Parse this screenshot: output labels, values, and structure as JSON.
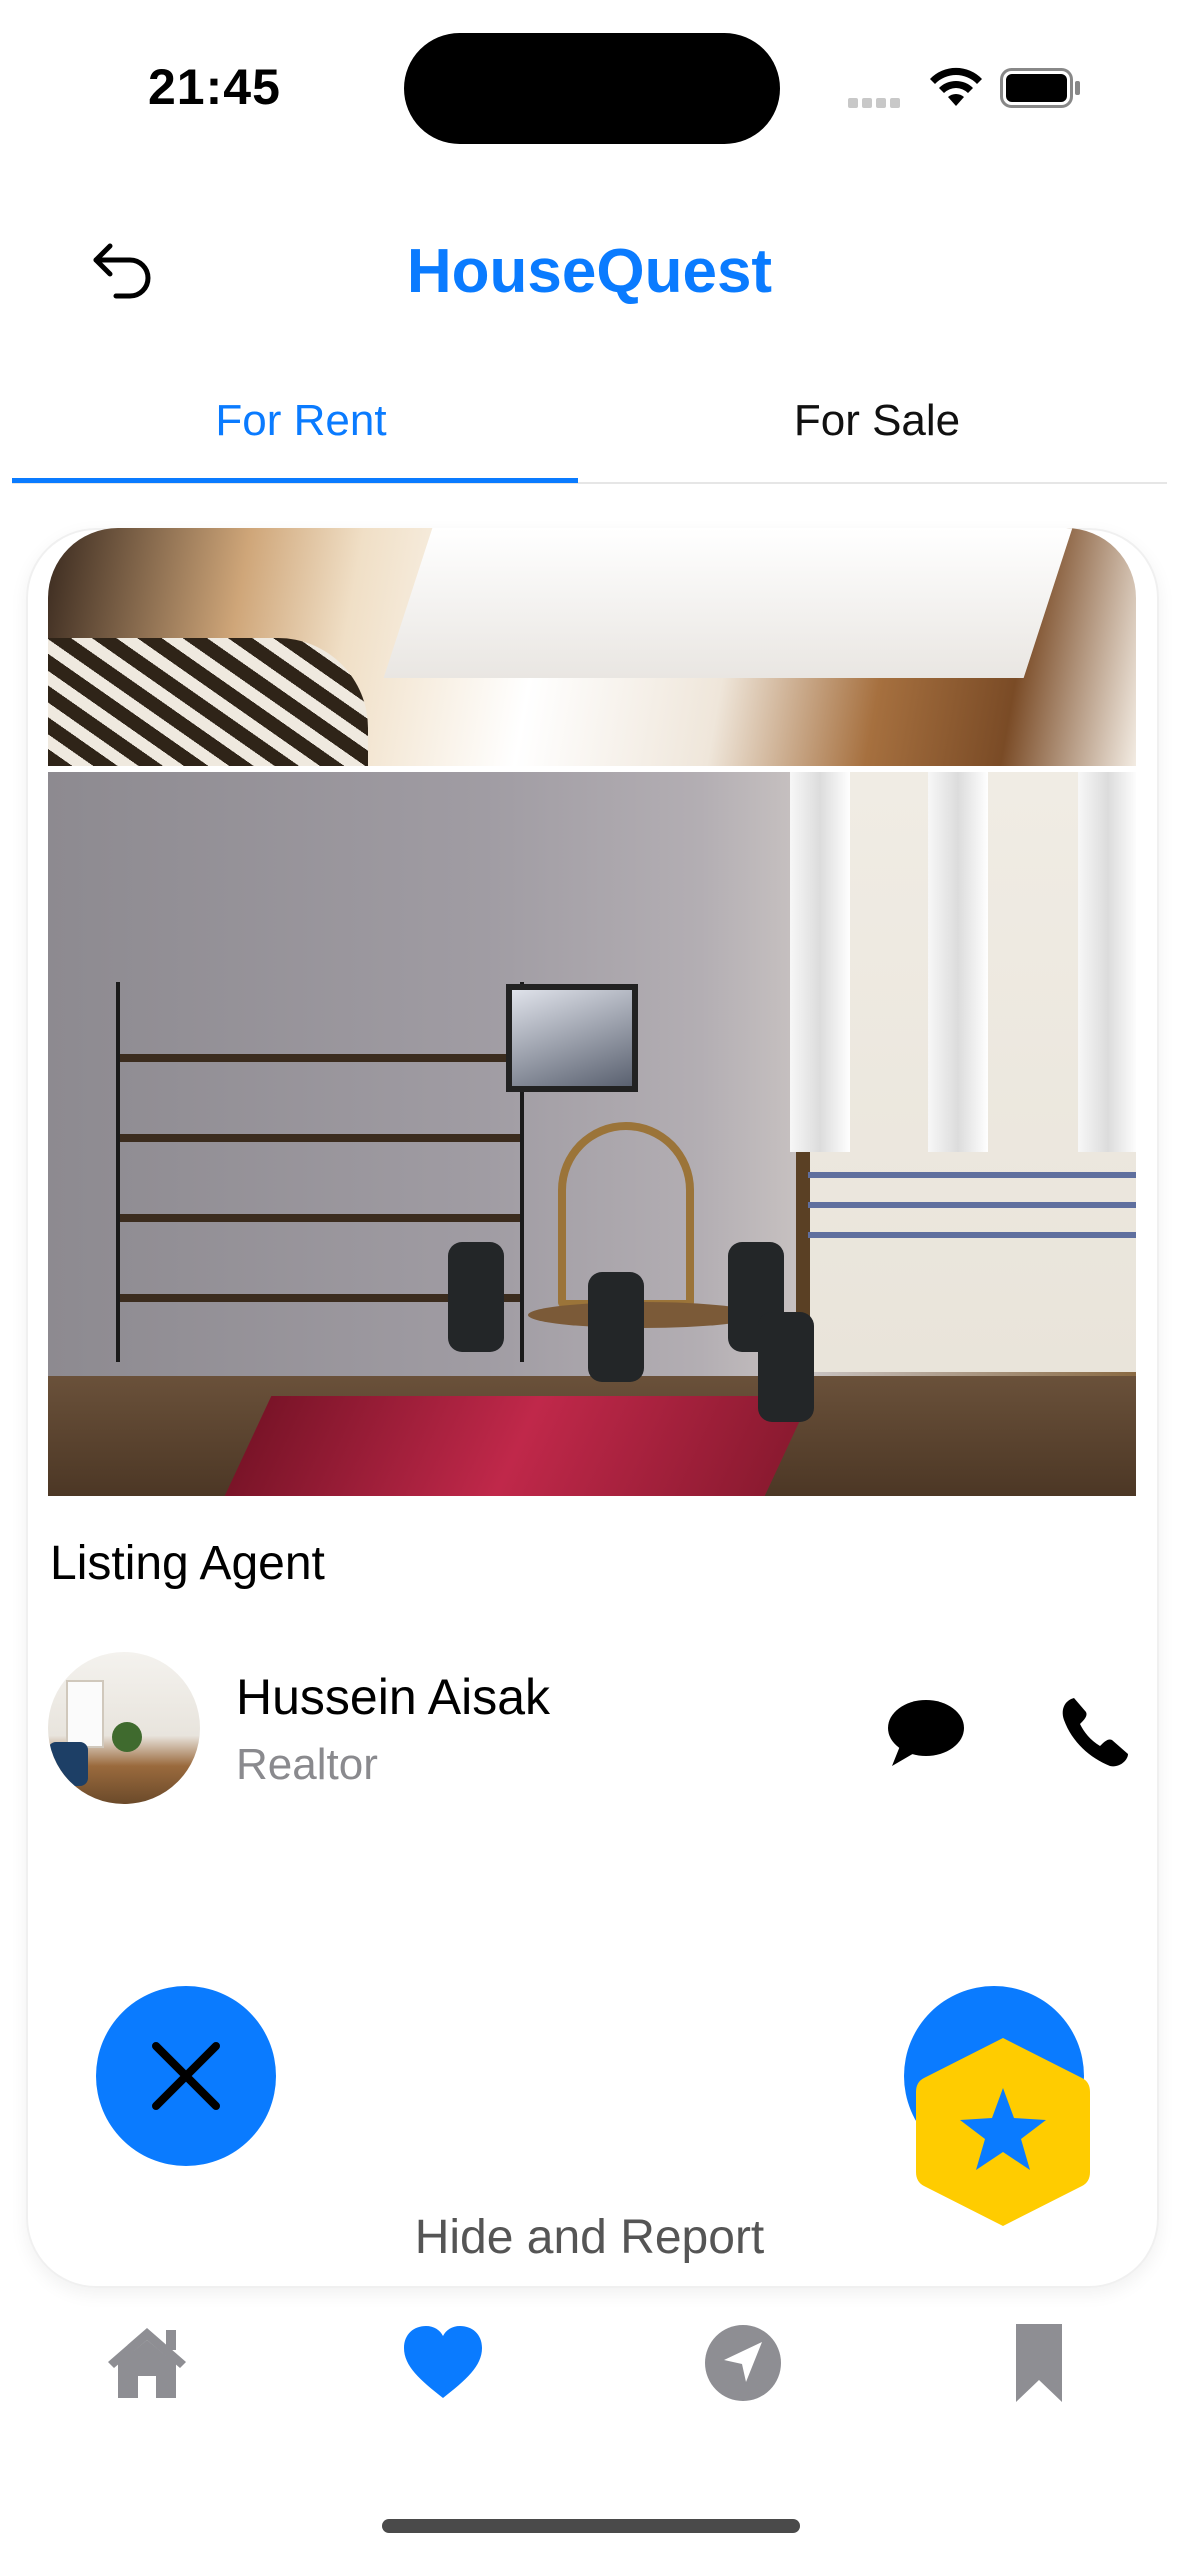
{
  "status_bar": {
    "time": "21:45",
    "icons": [
      "cellular-signal-icon",
      "wifi-icon",
      "battery-icon"
    ]
  },
  "header": {
    "title": "HouseQuest",
    "back_icon": "back-arrow-icon"
  },
  "tabs": [
    {
      "label": "For Rent",
      "selected": true
    },
    {
      "label": "For Sale",
      "selected": false
    }
  ],
  "listing": {
    "photos": [
      "bedroom-photo",
      "living-room-photo"
    ],
    "agent_section_title": "Listing Agent",
    "agent": {
      "name": "Hussein Aisak",
      "role": "Realtor"
    },
    "contact_icons": [
      "message-icon",
      "phone-icon"
    ]
  },
  "actions": {
    "dismiss_icon": "close-icon",
    "favorite_icon": "star-icon",
    "hide_report_label": "Hide and Report"
  },
  "tab_bar": {
    "items": [
      {
        "icon": "home-icon",
        "selected": false
      },
      {
        "icon": "heart-icon",
        "selected": true
      },
      {
        "icon": "location-arrow-icon",
        "selected": false
      },
      {
        "icon": "bookmark-icon",
        "selected": false
      }
    ]
  },
  "colors": {
    "accent": "#0a7bff",
    "badge": "#ffcc00",
    "inactive_icon": "#8e8e93"
  }
}
